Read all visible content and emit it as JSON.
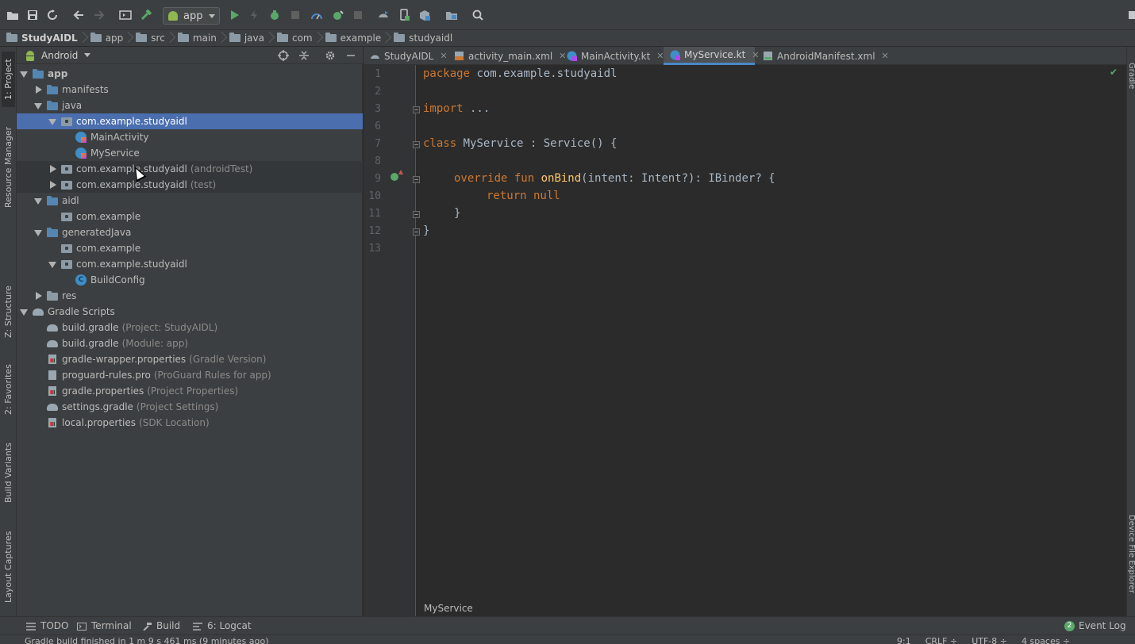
{
  "toolbar": {
    "run_config": "app",
    "buttons": [
      "open-icon",
      "save-icon",
      "sync-icon",
      "back-icon",
      "forward-icon",
      "run-config-icon",
      "make-icon",
      "run-icon",
      "apply-changes-icon",
      "debug-icon",
      "attach-icon",
      "profile-icon",
      "debug-app-icon",
      "stop-icon",
      "gradle-sync-icon",
      "avd-icon",
      "sdk-icon",
      "project-structure-icon",
      "search-icon"
    ]
  },
  "breadcrumb": [
    "StudyAIDL",
    "app",
    "src",
    "main",
    "java",
    "com",
    "example",
    "studyaidl"
  ],
  "left_strip": {
    "project": "1: Project",
    "resource_manager": "Resource Manager",
    "structure": "Z: Structure",
    "favorites": "2: Favorites",
    "build_variants": "Build Variants",
    "layout_captures": "Layout Captures"
  },
  "right_strip": {
    "gradle": "Gradle",
    "device_file_explorer": "Device File Explorer"
  },
  "project_panel": {
    "view": "Android",
    "tree": [
      {
        "label": "app",
        "hint": "",
        "depth": 0,
        "caret": "open",
        "icon": "folder-blue",
        "bold": true
      },
      {
        "label": "manifests",
        "hint": "",
        "depth": 1,
        "caret": "closed",
        "icon": "folder-blue"
      },
      {
        "label": "java",
        "hint": "",
        "depth": 1,
        "caret": "open",
        "icon": "folder-blue"
      },
      {
        "label": "com.example.studyaidl",
        "hint": "",
        "depth": 2,
        "caret": "open",
        "icon": "package",
        "selected": true
      },
      {
        "label": "MainActivity",
        "hint": "",
        "depth": 3,
        "caret": "none",
        "icon": "kotlin"
      },
      {
        "label": "MyService",
        "hint": "",
        "depth": 3,
        "caret": "none",
        "icon": "kotlin"
      },
      {
        "label": "com.example.studyaidl",
        "hint": "(androidTest)",
        "depth": 2,
        "caret": "closed",
        "icon": "package",
        "tinted": true
      },
      {
        "label": "com.example.studyaidl",
        "hint": "(test)",
        "depth": 2,
        "caret": "closed",
        "icon": "package",
        "tinted": true
      },
      {
        "label": "aidl",
        "hint": "",
        "depth": 1,
        "caret": "open",
        "icon": "folder-blue"
      },
      {
        "label": "com.example",
        "hint": "",
        "depth": 2,
        "caret": "none",
        "icon": "package"
      },
      {
        "label": "generatedJava",
        "hint": "",
        "depth": 1,
        "caret": "open",
        "icon": "folder-blue"
      },
      {
        "label": "com.example",
        "hint": "",
        "depth": 2,
        "caret": "none",
        "icon": "package"
      },
      {
        "label": "com.example.studyaidl",
        "hint": "",
        "depth": 2,
        "caret": "open",
        "icon": "package"
      },
      {
        "label": "BuildConfig",
        "hint": "",
        "depth": 3,
        "caret": "none",
        "icon": "class-c"
      },
      {
        "label": "res",
        "hint": "",
        "depth": 1,
        "caret": "closed",
        "icon": "folder-gray"
      },
      {
        "label": "Gradle Scripts",
        "hint": "",
        "depth": 0,
        "caret": "open",
        "icon": "gradle"
      },
      {
        "label": "build.gradle",
        "hint": "(Project: StudyAIDL)",
        "depth": 1,
        "caret": "none",
        "icon": "gradle"
      },
      {
        "label": "build.gradle",
        "hint": "(Module: app)",
        "depth": 1,
        "caret": "none",
        "icon": "gradle"
      },
      {
        "label": "gradle-wrapper.properties",
        "hint": "(Gradle Version)",
        "depth": 1,
        "caret": "none",
        "icon": "props"
      },
      {
        "label": "proguard-rules.pro",
        "hint": "(ProGuard Rules for app)",
        "depth": 1,
        "caret": "none",
        "icon": "file"
      },
      {
        "label": "gradle.properties",
        "hint": "(Project Properties)",
        "depth": 1,
        "caret": "none",
        "icon": "props"
      },
      {
        "label": "settings.gradle",
        "hint": "(Project Settings)",
        "depth": 1,
        "caret": "none",
        "icon": "gradle"
      },
      {
        "label": "local.properties",
        "hint": "(SDK Location)",
        "depth": 1,
        "caret": "none",
        "icon": "props"
      }
    ]
  },
  "tabs": [
    {
      "label": "StudyAIDL",
      "icon": "gradle-icon"
    },
    {
      "label": "activity_main.xml",
      "icon": "xml-layout-icon"
    },
    {
      "label": "MainActivity.kt",
      "icon": "kotlin-file-icon"
    },
    {
      "label": "MyService.kt",
      "icon": "kotlin-file-icon",
      "active": true
    },
    {
      "label": "AndroidManifest.xml",
      "icon": "manifest-icon"
    }
  ],
  "editor": {
    "line_numbers": [
      "1",
      "2",
      "3",
      "6",
      "7",
      "8",
      "9",
      "10",
      "11",
      "12",
      "13"
    ],
    "lines": {
      "l1_kw": "package",
      "l1_rest": " com.example.studyaidl",
      "l3_kw": "import",
      "l3_rest": " ...",
      "l7_kw": "class",
      "l7_rest": " MyService : Service() {",
      "l9_kw1": "override",
      "l9_kw2": " fun ",
      "l9_fn": "onBind",
      "l9_rest": "(intent: Intent?): IBinder? {",
      "l10_kw": "return",
      "l10_kw2": " null",
      "l11": "}",
      "l12": "}"
    },
    "breadcrumb": "MyService"
  },
  "bottom_tabs": {
    "todo": "TODO",
    "terminal": "Terminal",
    "build": "Build",
    "logcat": "6: Logcat",
    "event_count": "2",
    "event_log": "Event Log"
  },
  "status": {
    "message": "Gradle build finished in 1 m 9 s 461 ms (9 minutes ago)",
    "position": "9:1",
    "line_sep": "CRLF ÷",
    "encoding": "UTF-8 ÷",
    "indent": "4 spaces ÷"
  },
  "colors": {
    "selection": "#4b6eaf",
    "keyword": "#cc7832",
    "function": "#ffc66d",
    "text": "#a9b7c6"
  }
}
